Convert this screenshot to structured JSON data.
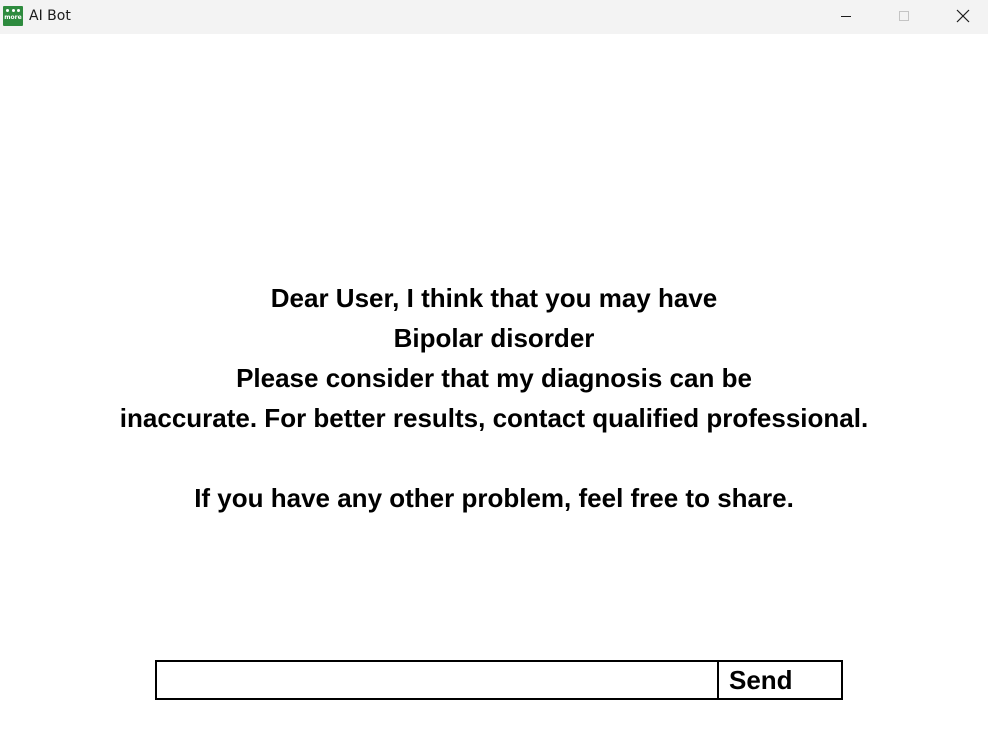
{
  "window": {
    "title": "AI Bot",
    "icon_name": "app-logo-icon",
    "icon_text": "more",
    "controls": {
      "minimize_icon": "minimize-icon",
      "maximize_icon": "maximize-icon",
      "close_icon": "close-icon"
    }
  },
  "chat": {
    "message_lines": [
      "Dear User, I think that you may have",
      "Bipolar disorder",
      "Please consider that my diagnosis can be",
      "inaccurate. For better results, contact qualified professional.",
      "",
      "If you have any other problem, feel free to share."
    ]
  },
  "input": {
    "value": "",
    "placeholder": ""
  },
  "send_button": {
    "label": "Send"
  },
  "colors": {
    "titlebar_bg": "#f3f3f3",
    "icon_bg": "#2e8b3e",
    "text": "#000000",
    "background": "#ffffff"
  }
}
